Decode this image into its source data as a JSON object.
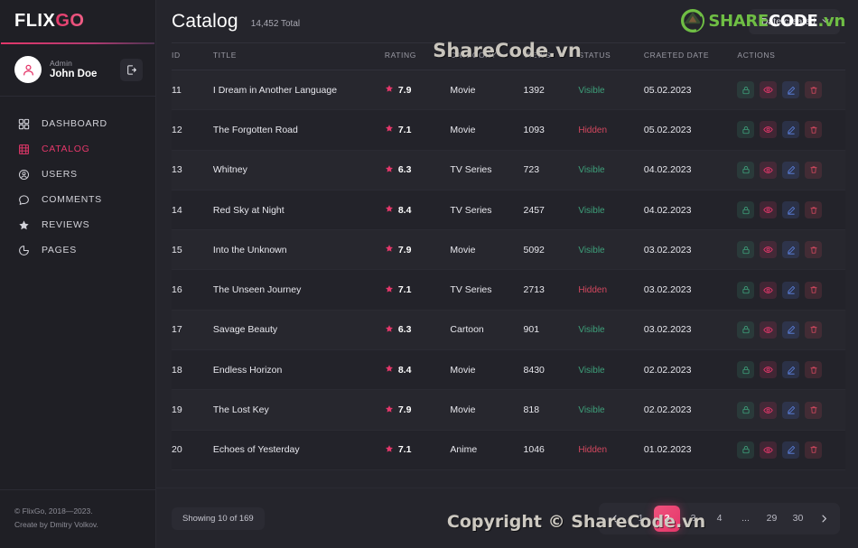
{
  "colors": {
    "accent_pink": "#e4376a",
    "status_visible": "#3ea17b",
    "status_hidden": "#d4485f",
    "sidebar_bg": "#1f1f25",
    "main_bg": "#25252c",
    "watermark_green": "#6fbe44"
  },
  "sidebar": {
    "brand": {
      "part1": "FLIX",
      "part2": "GO"
    },
    "profile": {
      "role": "Admin",
      "name": "John Doe",
      "logout_icon": "logout-icon",
      "avatar_icon": "user-avatar-icon"
    },
    "items": [
      {
        "label": "DASHBOARD",
        "icon": "grid-icon",
        "active": false
      },
      {
        "label": "CATALOG",
        "icon": "film-strip-icon",
        "active": true
      },
      {
        "label": "USERS",
        "icon": "user-circle-icon",
        "active": false
      },
      {
        "label": "COMMENTS",
        "icon": "comment-icon",
        "active": false
      },
      {
        "label": "REVIEWS",
        "icon": "star-icon",
        "active": false
      },
      {
        "label": "PAGES",
        "icon": "pages-icon",
        "active": false
      }
    ],
    "footer": {
      "line1": "© FlixGo, 2018—2023.",
      "line2": "Create by Dmitry Volkov."
    }
  },
  "header": {
    "title": "Catalog",
    "total": "14,452 Total",
    "sort_button": "Date created",
    "sort_chevron_icon": "chevron-down-icon"
  },
  "watermarks": {
    "logo_share": "SHARE",
    "logo_code": "CODE",
    "logo_vn": ".vn",
    "center_text": "ShareCode.vn",
    "bottom_text": "Copyright © ShareCode.vn"
  },
  "table": {
    "columns": [
      "ID",
      "TITLE",
      "RATING",
      "CATEGORY",
      "VIEWS",
      "STATUS",
      "CRAETED DATE",
      "ACTIONS"
    ],
    "action_icons": [
      "lock-icon",
      "eye-icon",
      "edit-icon",
      "trash-icon"
    ],
    "rows": [
      {
        "id": "11",
        "title": "I Dream in Another Language",
        "rating": "7.9",
        "category": "Movie",
        "views": "1392",
        "status": "Visible",
        "date": "05.02.2023"
      },
      {
        "id": "12",
        "title": "The Forgotten Road",
        "rating": "7.1",
        "category": "Movie",
        "views": "1093",
        "status": "Hidden",
        "date": "05.02.2023"
      },
      {
        "id": "13",
        "title": "Whitney",
        "rating": "6.3",
        "category": "TV Series",
        "views": "723",
        "status": "Visible",
        "date": "04.02.2023"
      },
      {
        "id": "14",
        "title": "Red Sky at Night",
        "rating": "8.4",
        "category": "TV Series",
        "views": "2457",
        "status": "Visible",
        "date": "04.02.2023"
      },
      {
        "id": "15",
        "title": "Into the Unknown",
        "rating": "7.9",
        "category": "Movie",
        "views": "5092",
        "status": "Visible",
        "date": "03.02.2023"
      },
      {
        "id": "16",
        "title": "The Unseen Journey",
        "rating": "7.1",
        "category": "TV Series",
        "views": "2713",
        "status": "Hidden",
        "date": "03.02.2023"
      },
      {
        "id": "17",
        "title": "Savage Beauty",
        "rating": "6.3",
        "category": "Cartoon",
        "views": "901",
        "status": "Visible",
        "date": "03.02.2023"
      },
      {
        "id": "18",
        "title": "Endless Horizon",
        "rating": "8.4",
        "category": "Movie",
        "views": "8430",
        "status": "Visible",
        "date": "02.02.2023"
      },
      {
        "id": "19",
        "title": "The Lost Key",
        "rating": "7.9",
        "category": "Movie",
        "views": "818",
        "status": "Visible",
        "date": "02.02.2023"
      },
      {
        "id": "20",
        "title": "Echoes of Yesterday",
        "rating": "7.1",
        "category": "Anime",
        "views": "1046",
        "status": "Hidden",
        "date": "01.02.2023"
      }
    ]
  },
  "footer_bar": {
    "showing": "Showing 10 of 169",
    "pagination": {
      "prev_icon": "chevron-left-icon",
      "next_icon": "chevron-right-icon",
      "pages": [
        "1",
        "2",
        "3",
        "4",
        "...",
        "29",
        "30"
      ],
      "active": "2"
    }
  }
}
